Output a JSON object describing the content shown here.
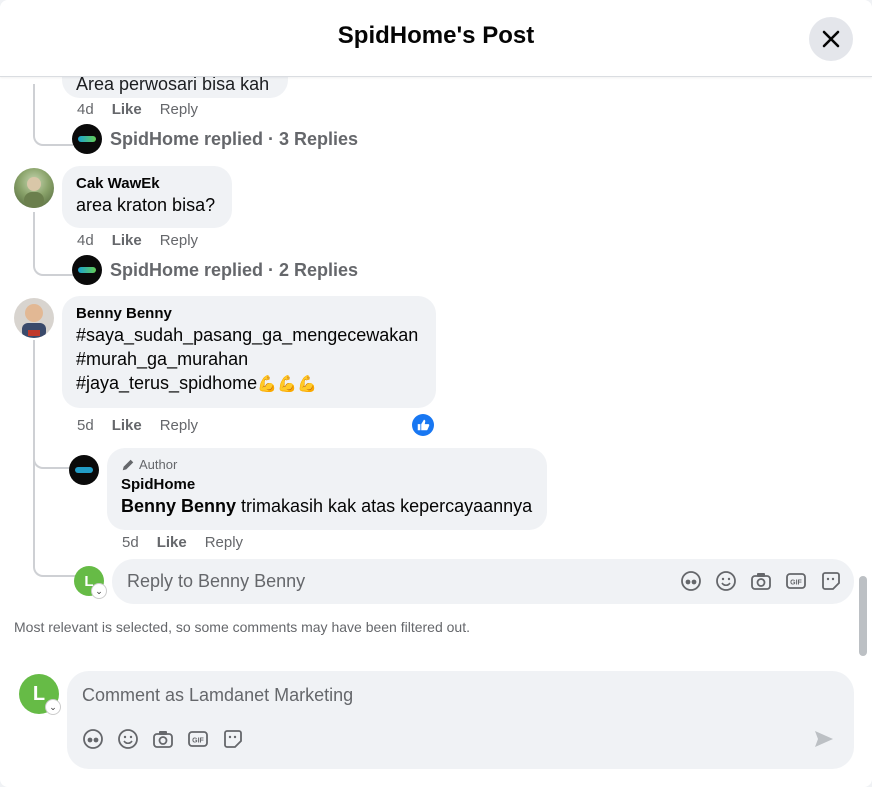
{
  "header": {
    "title": "SpidHome's Post"
  },
  "comments": {
    "partial": {
      "text": "Area perwosari bisa kah",
      "time": "4d",
      "like": "Like",
      "reply": "Reply",
      "replies_summary": "SpidHome replied · 3 Replies"
    },
    "c1": {
      "author": "Cak WawEk",
      "text": "area kraton bisa?",
      "time": "4d",
      "like": "Like",
      "reply": "Reply",
      "replies_summary": "SpidHome replied · 2 Replies"
    },
    "c2": {
      "author": "Benny Benny",
      "line1": "#saya_sudah_pasang_ga_mengecewakan",
      "line2": "#murah_ga_murahan",
      "line3": "#jaya_terus_spidhome",
      "emoji": "💪💪💪",
      "time": "5d",
      "like": "Like",
      "reply": "Reply"
    },
    "c2_reply": {
      "badge": "Author",
      "author": "SpidHome",
      "mention": "Benny Benny",
      "text": " trimakasih kak atas kepercayaannya",
      "time": "5d",
      "like": "Like",
      "reply": "Reply"
    }
  },
  "reply_input": {
    "placeholder": "Reply to Benny Benny"
  },
  "notice": "Most relevant is selected, so some comments may have been filtered out.",
  "comment_input": {
    "placeholder": "Comment as Lamdanet Marketing",
    "avatar_letter": "L"
  },
  "colors": {
    "accent": "#1877f2",
    "bubble": "#f0f2f5",
    "avatar_green": "#66bb46"
  },
  "icons": [
    "avatar-sticker-icon",
    "emoji-icon",
    "camera-icon",
    "gif-icon",
    "sticker-icon",
    "send-icon",
    "close-icon",
    "like-reaction-icon",
    "pencil-icon"
  ]
}
